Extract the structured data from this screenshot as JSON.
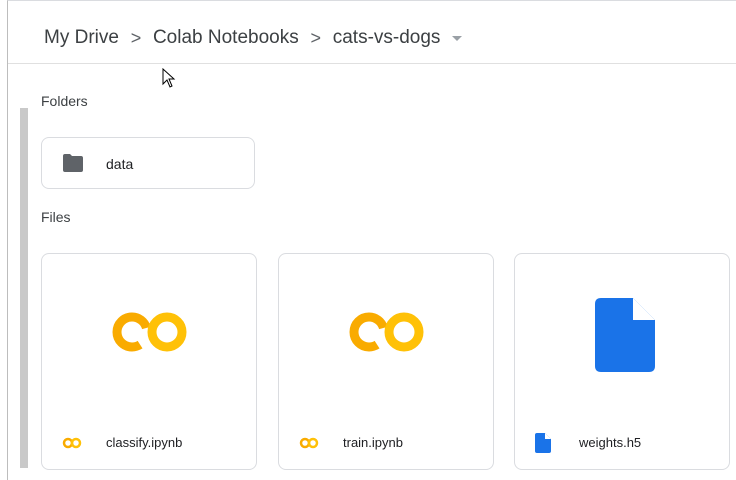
{
  "breadcrumb": {
    "items": [
      "My Drive",
      "Colab Notebooks",
      "cats-vs-dogs"
    ],
    "separator": ">"
  },
  "sections": {
    "folders_label": "Folders",
    "files_label": "Files"
  },
  "folders": [
    {
      "name": "data",
      "icon": "folder-icon"
    }
  ],
  "files": [
    {
      "name": "classify.ipynb",
      "icon": "colab-icon"
    },
    {
      "name": "train.ipynb",
      "icon": "colab-icon"
    },
    {
      "name": "weights.h5",
      "icon": "file-icon"
    }
  ],
  "colors": {
    "colab_orange": "#F9AB00",
    "colab_yellow": "#FFC107",
    "file_blue": "#1A73E8",
    "folder_gray": "#5F6368"
  }
}
